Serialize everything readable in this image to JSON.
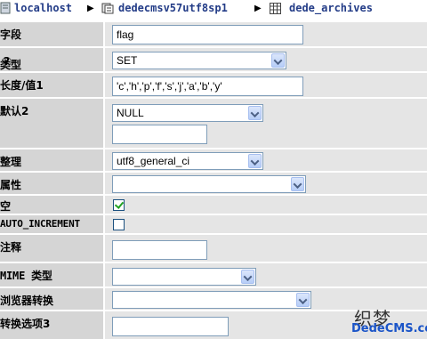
{
  "breadcrumb": {
    "server": "localhost",
    "database": "dedecmsv57utf8sp1",
    "table": "dede_archives"
  },
  "fields": {
    "field_label": "字段",
    "field_value": "flag",
    "type_label": "类型",
    "type_help": "?",
    "type_value": "SET",
    "length_label": "长度/值1",
    "length_value": "'c','h','p','f','s','j','a','b','y'",
    "default_label": "默认2",
    "default_value": "NULL",
    "default_text": "",
    "collation_label": "整理",
    "collation_value": "utf8_general_ci",
    "attributes_label": "属性",
    "attributes_value": "",
    "null_label": "空",
    "null_checked": true,
    "auto_increment_label": "AUTO_INCREMENT",
    "auto_increment_checked": false,
    "comment_label": "注释",
    "comment_value": "",
    "mime_label": "MIME 类型",
    "mime_value": "",
    "browser_transform_label": "浏览器转换",
    "browser_transform_value": "",
    "transform_options_label": "转换选项3",
    "transform_options_value": ""
  },
  "watermark": {
    "chinese": "织梦",
    "site": "DedeCMS.com"
  }
}
